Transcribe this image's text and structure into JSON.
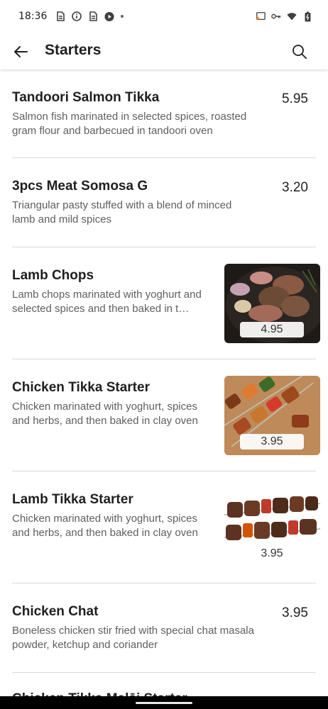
{
  "status_bar": {
    "time": "18:36",
    "left_icons": [
      "sim-icon",
      "info-icon",
      "sim-icon",
      "media-play-icon"
    ],
    "right_icons": [
      "cast-icon",
      "vpn-key-icon",
      "wifi-icon",
      "battery-icon"
    ]
  },
  "app_bar": {
    "title": "Starters",
    "back_icon": "arrow-left-icon",
    "search_icon": "search-icon"
  },
  "items": [
    {
      "name": "Tandoori Salmon Tikka",
      "description": "Salmon fish marinated in selected spices, roasted gram flour and barbecued in tandoori oven",
      "price": "5.95",
      "has_image": false
    },
    {
      "name": "3pcs Meat Somosa G",
      "description": "Triangular pasty stuffed with a blend of minced lamb and mild spices",
      "price": "3.20",
      "has_image": false
    },
    {
      "name": "Lamb Chops",
      "description": "Lamb chops marinated with yoghurt and selected spices and then baked in t…",
      "price": "4.95",
      "has_image": true
    },
    {
      "name": "Chicken Tikka Starter",
      "description": "Chicken marinated with yoghurt, spices and herbs, and then baked in clay oven",
      "price": "3.95",
      "has_image": true
    },
    {
      "name": "Lamb Tikka Starter",
      "description": "Chicken marinated with yoghurt, spices and herbs, and then baked in clay oven",
      "price": "3.95",
      "has_image": true
    },
    {
      "name": "Chicken Chat",
      "description": "Boneless chicken stir fried with special chat masala powder, ketchup and coriander",
      "price": "3.95",
      "has_image": false
    }
  ],
  "next_item_partial": "Chicken Tikka Malāi Starter"
}
